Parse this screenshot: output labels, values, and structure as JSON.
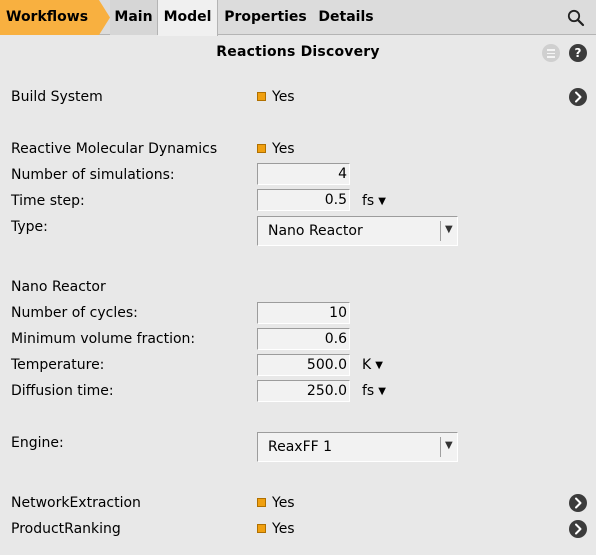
{
  "tabs": {
    "workflows": "Workflows",
    "main": "Main",
    "model": "Model",
    "properties": "Properties",
    "details": "Details"
  },
  "header": {
    "title": "Reactions Discovery",
    "help": "?"
  },
  "build_system": {
    "label": "Build System",
    "value": "Yes"
  },
  "rmd": {
    "label": "Reactive Molecular Dynamics",
    "value": "Yes",
    "num_sims_label": "Number of simulations:",
    "num_sims_value": "4",
    "time_step_label": "Time step:",
    "time_step_value": "0.5",
    "time_step_unit": "fs",
    "type_label": "Type:",
    "type_value": "Nano Reactor"
  },
  "nano_reactor": {
    "heading": "Nano Reactor",
    "cycles_label": "Number of cycles:",
    "cycles_value": "10",
    "minvol_label": "Minimum volume fraction:",
    "minvol_value": "0.6",
    "temp_label": "Temperature:",
    "temp_value": "500.0",
    "temp_unit": "K",
    "diff_label": "Diffusion time:",
    "diff_value": "250.0",
    "diff_unit": "fs"
  },
  "engine": {
    "label": "Engine:",
    "value": "ReaxFF 1"
  },
  "network_extraction": {
    "label": "NetworkExtraction",
    "value": "Yes"
  },
  "product_ranking": {
    "label": "ProductRanking",
    "value": "Yes"
  },
  "colors": {
    "accent": "#f8b040",
    "check": "#f0a010",
    "background": "#e8e8e8"
  }
}
